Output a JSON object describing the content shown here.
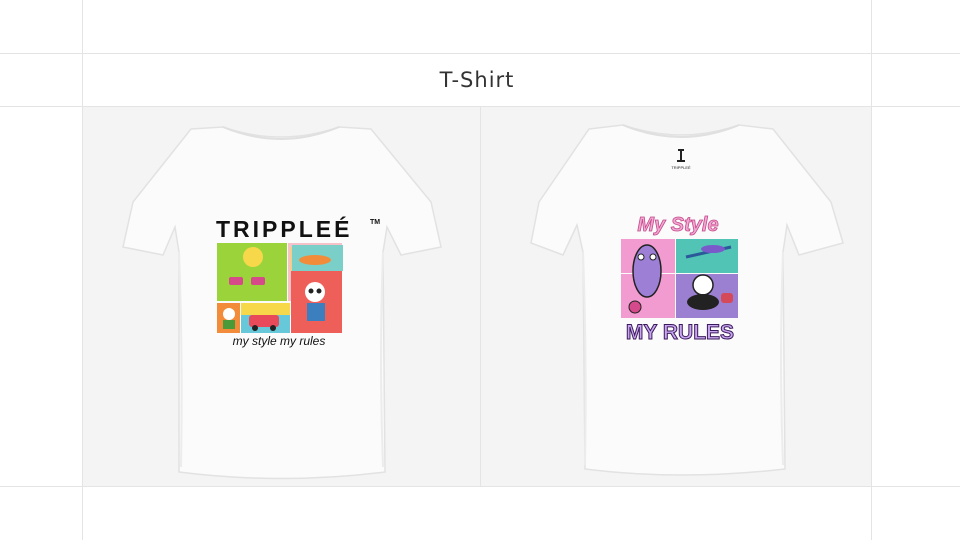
{
  "page": {
    "title": "T-Shirt"
  },
  "shirts": [
    {
      "brand": "TRIPPLEÉ",
      "tm": "TM",
      "tagline": "my style my rules"
    },
    {
      "script_title": "My Style",
      "bold_title": "MY RULES",
      "logo_text": "TRIPPLEÉ"
    }
  ]
}
